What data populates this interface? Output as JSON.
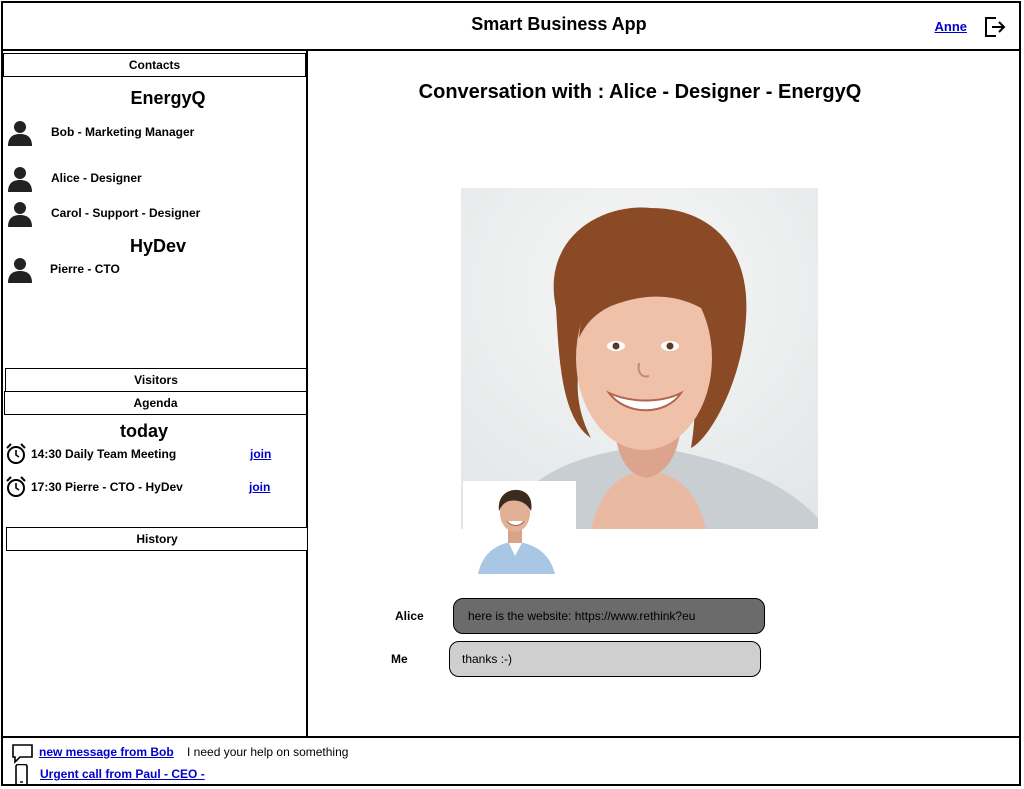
{
  "header": {
    "title": "Smart Business App",
    "user_name": "Anne"
  },
  "sidebar": {
    "contacts_label": "Contacts",
    "groups": [
      {
        "name": "EnergyQ",
        "contacts": [
          {
            "label": "Bob - Marketing Manager"
          },
          {
            "label": "Alice - Designer"
          },
          {
            "label": "Carol - Support - Designer"
          }
        ]
      },
      {
        "name": "HyDev",
        "contacts": [
          {
            "label": "Pierre - CTO"
          }
        ]
      }
    ],
    "visitors_label": "Visitors",
    "agenda_label": "Agenda",
    "agenda_day": "today",
    "agenda": [
      {
        "text": "14:30 Daily Team Meeting",
        "action": "join"
      },
      {
        "text": "17:30 Pierre - CTO - HyDev",
        "action": "join"
      }
    ],
    "history_label": "History"
  },
  "main": {
    "conversation_title": "Conversation with : Alice - Designer - EnergyQ",
    "messages": [
      {
        "sender": "Alice",
        "text": "here is the website: https://www.rethink?eu",
        "style": "dark"
      },
      {
        "sender": "Me",
        "text": "thanks :-)",
        "style": "light"
      }
    ]
  },
  "footer": {
    "notifications": [
      {
        "icon": "chat-bubble-icon",
        "link": "new message from Bob",
        "message": "I need your help on something"
      },
      {
        "icon": "mobile-phone-icon",
        "link": "Urgent call from Paul -  CEO -",
        "message": ""
      }
    ]
  }
}
